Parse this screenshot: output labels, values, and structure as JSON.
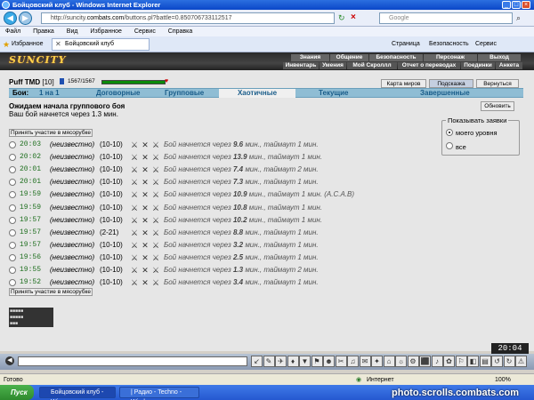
{
  "window": {
    "title": "Бойцовский клуб - Windows Internet Explorer"
  },
  "address": {
    "url_prefix": "http://suncity.",
    "url_domain": "combats.com",
    "url_suffix": "/buttons.pl?battle=0.850706733112517",
    "search_placeholder": "Google"
  },
  "menu": [
    "Файл",
    "Правка",
    "Вид",
    "Избранное",
    "Сервис",
    "Справка"
  ],
  "favbar": {
    "favorites": "Избранное",
    "tab": "Бойцовский клуб",
    "page": "Страница",
    "security": "Безопасность",
    "service": "Сервис"
  },
  "game": {
    "logo": "SUNCITY",
    "topnav": [
      "Знания",
      "Общение",
      "Безопасность",
      "Персонаж",
      "Выход"
    ],
    "subnav": [
      "Инвентарь",
      "Умения",
      "Мой Скроллл",
      "Отчет о переводах",
      "Поединки",
      "Анкета"
    ],
    "user": {
      "name": "Puff TMD",
      "level": "[10]",
      "hp": "1567/1567"
    },
    "buttons": {
      "map": "Карта миров",
      "hint": "Подсказка",
      "back": "Вернуться",
      "refresh": "Обновить",
      "accept": "Принять участие в мясорубке"
    },
    "tabs": [
      "Бои:",
      "1 на 1",
      "Договорные",
      "Групповые",
      "Хаотичные",
      "Текущие",
      "Завершенные"
    ],
    "wait_title": "Ожидаем начала группового боя",
    "wait_msg": "Ваш бой начнется через 1.3 мин.",
    "filter": {
      "legend": "Показывать заявки",
      "opt1": "моего уровня",
      "opt2": "все"
    },
    "rows": [
      {
        "time": "20:03",
        "name": "(неизвестно)",
        "lv": "(10-10)",
        "pre": "Бой начнется через ",
        "min": "9.6",
        "post": " мин., таймаут 1 мин."
      },
      {
        "time": "20:02",
        "name": "(неизвестно)",
        "lv": "(10-10)",
        "pre": "Бой начнется через ",
        "min": "13.9",
        "post": " мин., таймаут 1 мин."
      },
      {
        "time": "20:01",
        "name": "(неизвестно)",
        "lv": "(10-10)",
        "pre": "Бой начнется через ",
        "min": "7.4",
        "post": " мин., таймаут 2 мин."
      },
      {
        "time": "20:01",
        "name": "(неизвестно)",
        "lv": "(10-10)",
        "pre": "Бой начнется через ",
        "min": "7.3",
        "post": " мин., таймаут 1 мин."
      },
      {
        "time": "19:59",
        "name": "(неизвестно)",
        "lv": "(10-10)",
        "pre": "Бой начнется через ",
        "min": "10.9",
        "post": " мин., таймаут 1 мин. (А.С.А.В)"
      },
      {
        "time": "19:59",
        "name": "(неизвестно)",
        "lv": "(10-10)",
        "pre": "Бой начнется через ",
        "min": "10.8",
        "post": " мин., таймаут 1 мин."
      },
      {
        "time": "19:57",
        "name": "(неизвестно)",
        "lv": "(10-10)",
        "pre": "Бой начнется через ",
        "min": "10.2",
        "post": " мин., таймаут 1 мин."
      },
      {
        "time": "19:57",
        "name": "(неизвестно)",
        "lv": "(2-21)",
        "pre": "Бой начнется через ",
        "min": "8.8",
        "post": " мин., таймаут 1 мин."
      },
      {
        "time": "19:57",
        "name": "(неизвестно)",
        "lv": "(10-10)",
        "pre": "Бой начнется через ",
        "min": "3.2",
        "post": " мин., таймаут 1 мин."
      },
      {
        "time": "19:56",
        "name": "(неизвестно)",
        "lv": "(10-10)",
        "pre": "Бой начнется через ",
        "min": "2.5",
        "post": " мин., таймаут 1 мин."
      },
      {
        "time": "19:55",
        "name": "(неизвестно)",
        "lv": "(10-10)",
        "pre": "Бой начнется через ",
        "min": "1.3",
        "post": " мин., таймаут 2 мин."
      },
      {
        "time": "19:52",
        "name": "(неизвестно)",
        "lv": "(10-10)",
        "pre": "Бой начнется через ",
        "min": "3.4",
        "post": " мин., таймаут 1 мин."
      }
    ],
    "clock": "20:04"
  },
  "status": {
    "left": "Готово",
    "zone": "Интернет",
    "zoom": "100%"
  },
  "taskbar": {
    "start": "Пуск",
    "task1": "Бойцовский клуб - Wi...",
    "task2": "| Радио - Techno - Wind..."
  },
  "watermark": "photo.scrolls.combats.com"
}
